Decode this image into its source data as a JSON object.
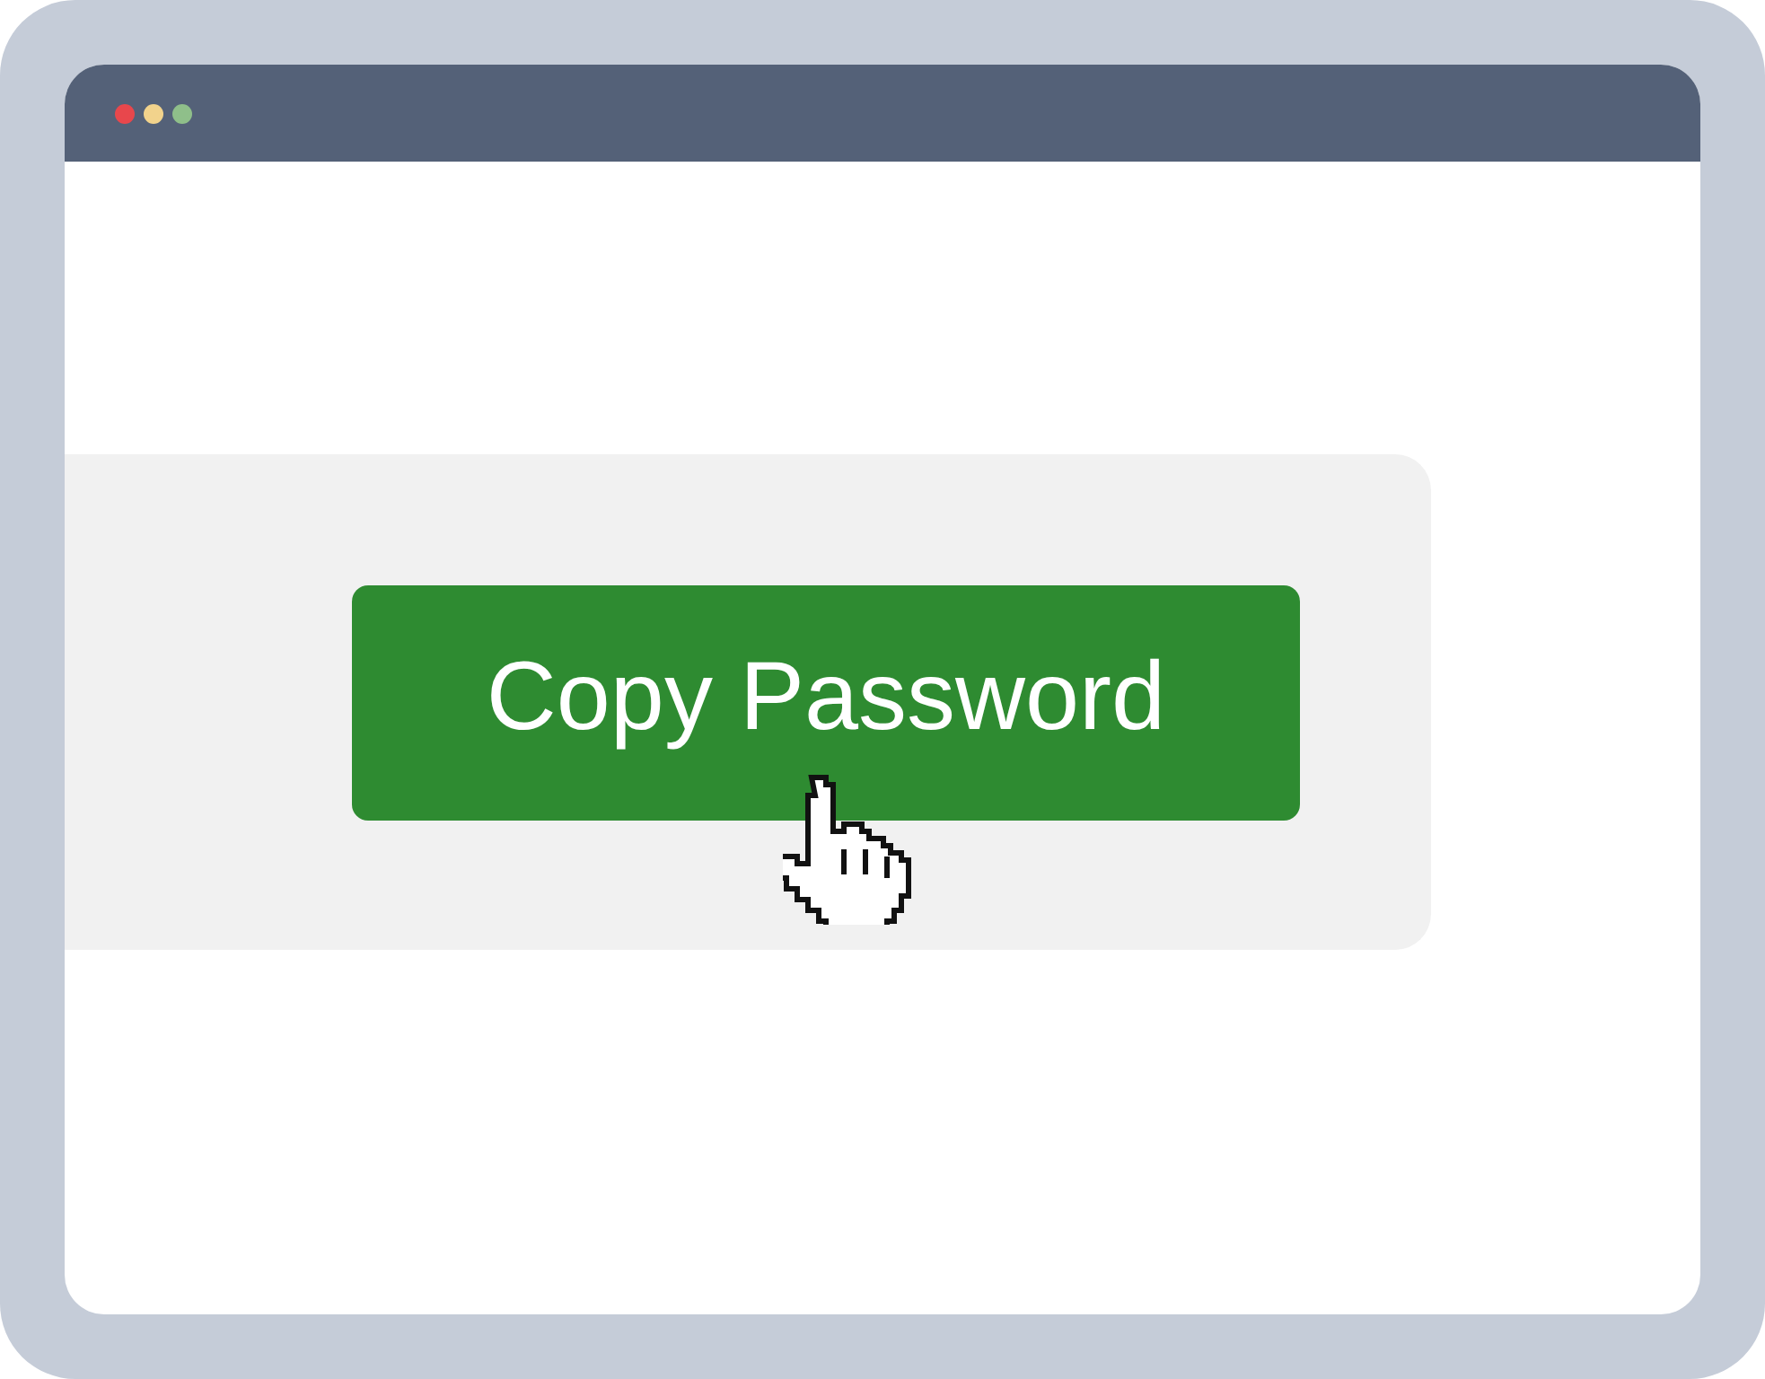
{
  "window_controls": [
    {
      "color": "#e8474c"
    },
    {
      "color": "#f2d38c"
    },
    {
      "color": "#8fbf8a"
    }
  ],
  "button": {
    "label": "Copy Password"
  }
}
